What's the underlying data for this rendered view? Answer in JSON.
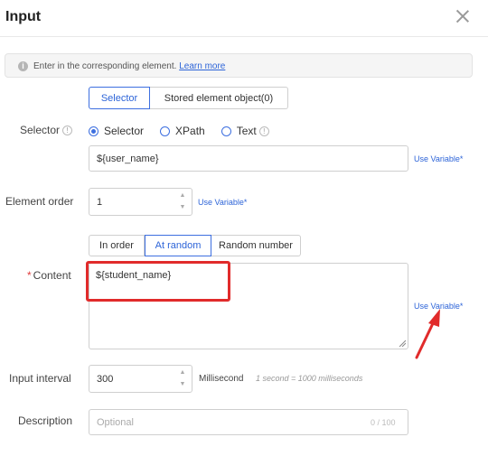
{
  "dialog": {
    "title": "Input"
  },
  "info": {
    "text": "Enter in the corresponding element.",
    "link": "Learn more"
  },
  "target_tabs": [
    {
      "label": "Selector",
      "active": true
    },
    {
      "label": "Stored element object(0)",
      "active": false
    }
  ],
  "selector": {
    "label": "Selector",
    "options": [
      "Selector",
      "XPath",
      "Text"
    ],
    "selected": "Selector",
    "value": "${user_name}",
    "use_variable": "Use Variable*"
  },
  "element_order": {
    "label": "Element order",
    "value": "1",
    "use_variable": "Use Variable*"
  },
  "order_tabs": [
    {
      "label": "In order",
      "active": false
    },
    {
      "label": "At random",
      "active": true
    },
    {
      "label": "Random number",
      "active": false
    }
  ],
  "content": {
    "label": "Content",
    "value": "${student_name}",
    "use_variable": "Use Variable*"
  },
  "input_interval": {
    "label": "Input interval",
    "value": "300",
    "unit": "Millisecond",
    "hint": "1 second = 1000 milliseconds"
  },
  "description": {
    "label": "Description",
    "placeholder": "Optional",
    "counter": "0 / 100"
  },
  "colors": {
    "accent": "#2d64d8",
    "highlight": "#e12b2b",
    "required": "#e03c3c"
  }
}
